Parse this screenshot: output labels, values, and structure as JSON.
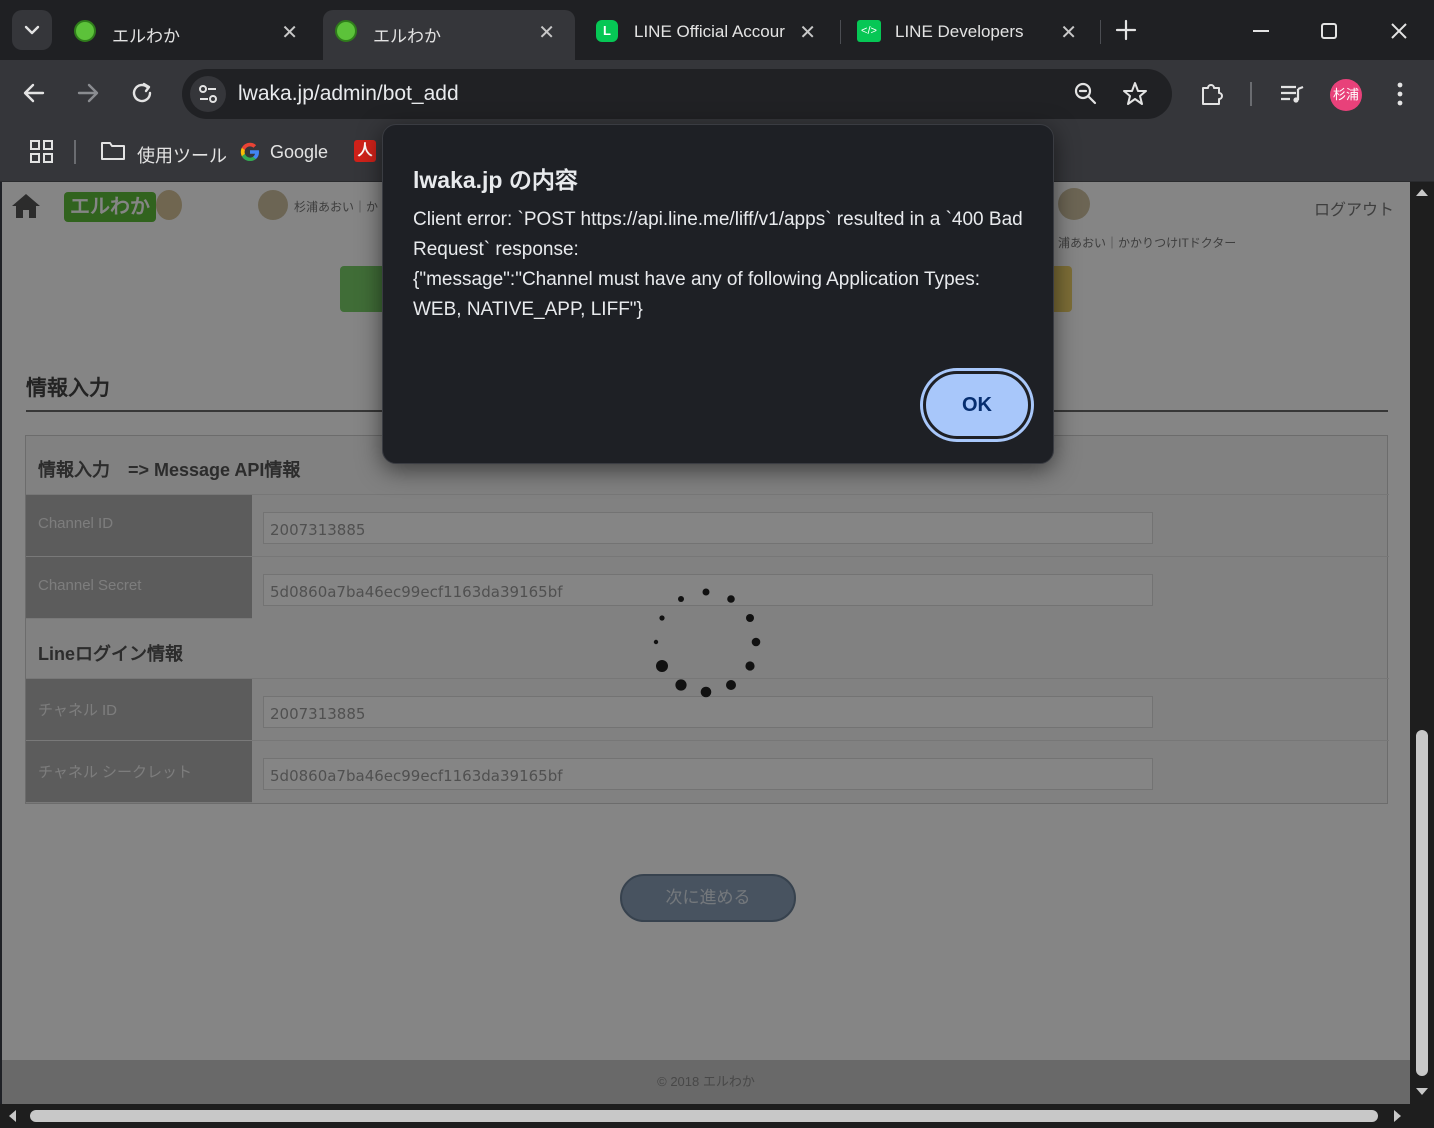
{
  "tabs": [
    {
      "title": "エルわか",
      "active": false
    },
    {
      "title": "エルわか",
      "active": true
    },
    {
      "title": "LINE Official Accour",
      "active": false
    },
    {
      "title": "LINE Developers",
      "active": false
    }
  ],
  "omnibox": {
    "url": "lwaka.jp/admin/bot_add"
  },
  "profile": {
    "label": "杉浦",
    "color": "#e8417a"
  },
  "bookmarks": [
    {
      "label": "使用ツール"
    },
    {
      "label": "Google"
    }
  ],
  "page": {
    "logo": "エルわか",
    "user_left": "杉浦あおい｜か",
    "user_right": "浦あおい｜かかりつけITドクター",
    "logout": "ログアウト",
    "section_title": "情報入力",
    "form": {
      "header1": "情報入力　=> Message API情報",
      "rows1": [
        {
          "label": "Channel ID",
          "value": "2007313885"
        },
        {
          "label": "Channel Secret",
          "value": "5d0860a7ba46ec99ecf1163da39165bf"
        }
      ],
      "header2": "Lineログイン情報",
      "rows2": [
        {
          "label": "チャネル ID",
          "value": "2007313885"
        },
        {
          "label": "チャネル シークレット",
          "value": "5d0860a7ba46ec99ecf1163da39165bf"
        }
      ]
    },
    "next_button": "次に進める",
    "footer": "© 2018 エルわか"
  },
  "dialog": {
    "title": "lwaka.jp の内容",
    "message": "Client error: `POST https://api.line.me/liff/v1/apps` resulted in a `400 Bad Request` response:\n{\"message\":\"Channel must have any of following Application Types: WEB, NATIVE_APP, LIFF\"}",
    "ok_label": "OK"
  },
  "colors": {
    "accent": "#a8c7fa",
    "line_green": "#06c755"
  }
}
